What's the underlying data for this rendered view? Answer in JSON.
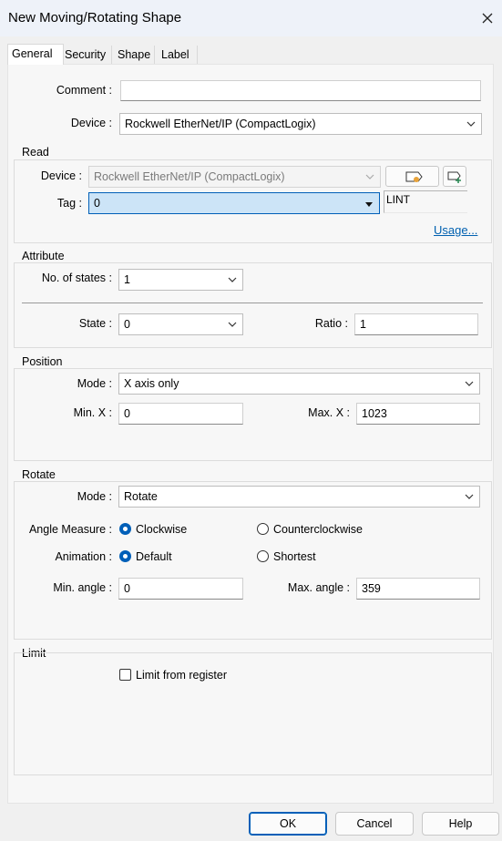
{
  "window": {
    "title": "New Moving/Rotating Shape"
  },
  "tabs": [
    "General",
    "Security",
    "Shape",
    "Label"
  ],
  "general": {
    "comment_label": "Comment :",
    "comment_value": "",
    "device_label": "Device :",
    "device_value": "Rockwell EtherNet/IP (CompactLogix)"
  },
  "read": {
    "title": "Read",
    "device_label": "Device :",
    "device_value": "Rockwell EtherNet/IP (CompactLogix)",
    "tag_label": "Tag :",
    "tag_value": "0",
    "type_value": "LINT",
    "usage_link": "Usage..."
  },
  "attribute": {
    "title": "Attribute",
    "states_label": "No. of states :",
    "states_value": "1",
    "state_label": "State :",
    "state_value": "0",
    "ratio_label": "Ratio :",
    "ratio_value": "1"
  },
  "position": {
    "title": "Position",
    "mode_label": "Mode :",
    "mode_value": "X axis only",
    "minx_label": "Min. X :",
    "minx_value": "0",
    "maxx_label": "Max. X :",
    "maxx_value": "1023"
  },
  "rotate": {
    "title": "Rotate",
    "mode_label": "Mode :",
    "mode_value": "Rotate",
    "angle_label": "Angle Measure :",
    "clockwise": "Clockwise",
    "counterclockwise": "Counterclockwise",
    "animation_label": "Animation :",
    "default": "Default",
    "shortest": "Shortest",
    "minangle_label": "Min. angle :",
    "minangle_value": "0",
    "maxangle_label": "Max. angle :",
    "maxangle_value": "359"
  },
  "limit": {
    "title": "Limit",
    "checkbox_label": "Limit from register"
  },
  "buttons": {
    "ok": "OK",
    "cancel": "Cancel",
    "help": "Help"
  },
  "colors": {
    "accent": "#005fb8",
    "tag_highlight": "#cce4f7",
    "link": "#0060b0"
  }
}
